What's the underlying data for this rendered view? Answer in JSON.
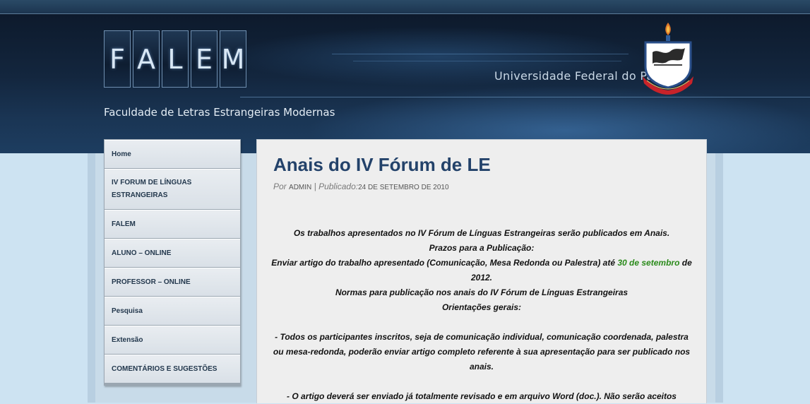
{
  "header": {
    "logo_letters": [
      "F",
      "A",
      "L",
      "E",
      "M"
    ],
    "university": "Universidade Federal do Pará",
    "tagline": "Faculdade de Letras Estrangeiras Modernas"
  },
  "nav": {
    "items": [
      {
        "label": "Home"
      },
      {
        "label": "IV FORUM DE LÍNGUAS ESTRANGEIRAS"
      },
      {
        "label": "FALEM"
      },
      {
        "label": "ALUNO – ONLINE"
      },
      {
        "label": "PROFESSOR – ONLINE"
      },
      {
        "label": "Pesquisa"
      },
      {
        "label": "Extensão"
      },
      {
        "label": "COMENTÁRIOS E SUGESTÕES"
      }
    ]
  },
  "post": {
    "title": "Anais do IV Fórum de LE",
    "by_label": "Por",
    "author": "ADMIN",
    "separator": "|",
    "published_label": "Publicado:",
    "date": "24 DE SETEMBRO DE 2010",
    "lines": {
      "l1": "Os trabalhos apresentados no IV Fórum de Línguas Estrangeiras serão publicados em Anais.",
      "l2": "Prazos para a Publicação:",
      "l3a": "Enviar artigo do trabalho apresentado (Comunicação, Mesa Redonda ou Palestra) até ",
      "l3_highlight": "30 de setembro",
      "l3b": " de 2012.",
      "l4": "Normas para publicação nos anais do IV Fórum de Línguas Estrangeiras",
      "l5": "Orientações gerais:",
      "l6": "- Todos os participantes inscritos, seja de comunicação individual, comunicação coordenada, palestra ou mesa-redonda, poderão enviar artigo completo referente à sua apresentação para ser publicado nos anais.",
      "l7": "- O artigo deverá ser enviado já totalmente revisado e em arquivo Word (doc.). Não serão aceitos"
    }
  },
  "colors": {
    "title": "#23426a",
    "highlight": "#2a8a1a",
    "nav_text": "#23384d"
  }
}
